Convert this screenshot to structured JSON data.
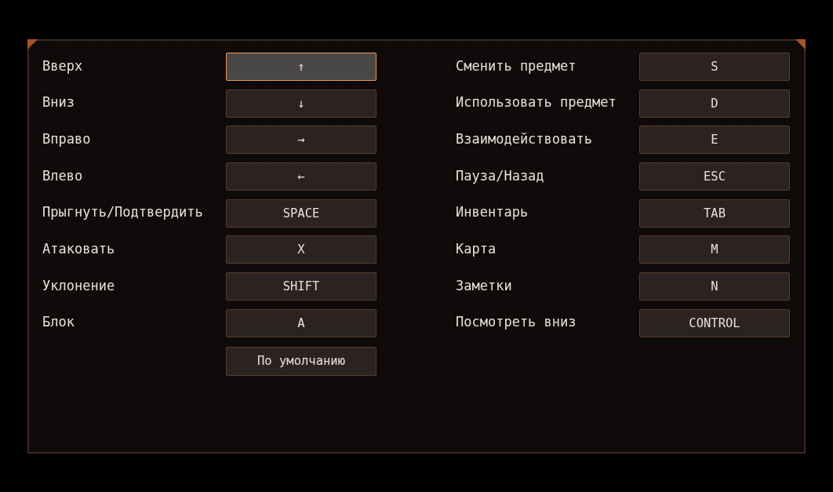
{
  "left_bindings": [
    {
      "action": "Вверх",
      "key": "↑",
      "selected": true
    },
    {
      "action": "Вниз",
      "key": "↓",
      "selected": false
    },
    {
      "action": "Вправо",
      "key": "→",
      "selected": false
    },
    {
      "action": "Влево",
      "key": "←",
      "selected": false
    },
    {
      "action": "Прыгнуть/Подтвердить",
      "key": "SPACE",
      "selected": false
    },
    {
      "action": "Атаковать",
      "key": "X",
      "selected": false
    },
    {
      "action": "Уклонение",
      "key": "SHIFT",
      "selected": false
    },
    {
      "action": "Блок",
      "key": "A",
      "selected": false
    }
  ],
  "default_button": "По умолчанию",
  "right_bindings": [
    {
      "action": "Сменить предмет",
      "key": "S",
      "selected": false
    },
    {
      "action": "Использовать предмет",
      "key": "D",
      "selected": false
    },
    {
      "action": "Взаимодействовать",
      "key": "E",
      "selected": false
    },
    {
      "action": "Пауза/Назад",
      "key": "ESC",
      "selected": false
    },
    {
      "action": "Инвентарь",
      "key": "TAB",
      "selected": false
    },
    {
      "action": "Карта",
      "key": "M",
      "selected": false
    },
    {
      "action": "Заметки",
      "key": "N",
      "selected": false
    },
    {
      "action": "Посмотреть вниз",
      "key": "CONTROL",
      "selected": false
    }
  ]
}
